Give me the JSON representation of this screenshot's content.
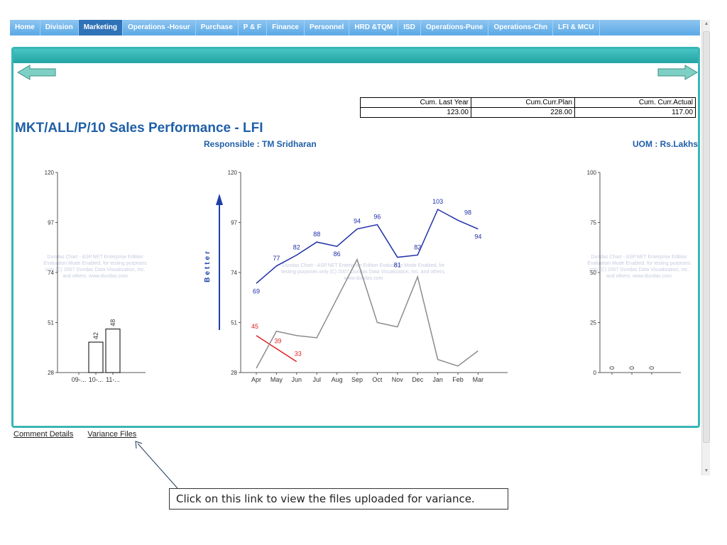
{
  "nav": {
    "tabs": [
      {
        "label": "Home",
        "active": false
      },
      {
        "label": "Division",
        "active": false
      },
      {
        "label": "Marketing",
        "active": true
      },
      {
        "label": "Operations -Hosur",
        "active": false
      },
      {
        "label": "Purchase",
        "active": false
      },
      {
        "label": "P & F",
        "active": false
      },
      {
        "label": "Finance",
        "active": false
      },
      {
        "label": "Personnel",
        "active": false
      },
      {
        "label": "HRD &TQM",
        "active": false
      },
      {
        "label": "ISD",
        "active": false
      },
      {
        "label": "Operations-Pune",
        "active": false
      },
      {
        "label": "Operations-Chn",
        "active": false
      },
      {
        "label": "LFI & MCU",
        "active": false
      }
    ]
  },
  "summary": {
    "headers": [
      "Cum. Last Year",
      "Cum.Curr.Plan",
      "Cum. Curr.Actual"
    ],
    "values": [
      "123.00",
      "228.00",
      "117.00"
    ]
  },
  "header": {
    "title": "MKT/ALL/P/10 Sales Performance - LFI",
    "responsible": "Responsible : TM Sridharan",
    "uom": "UOM : Rs.Lakhs"
  },
  "better_label": "Better",
  "watermark_text": "Dundas Chart - ASP.NET Enterprise Edition Evaluation Mode Enabled, for testing purposes only (C) 2007 Dundas Data Visualization, Inc. and others. www.dundas.com",
  "chart_data": [
    {
      "type": "bar",
      "categories": [
        "09-...",
        "10-...",
        "11-..."
      ],
      "values": [
        null,
        42,
        48
      ],
      "data_labels": [
        "",
        "42",
        "48"
      ],
      "ylim": [
        28,
        120
      ],
      "yticks": [
        28,
        51,
        74,
        97,
        120
      ]
    },
    {
      "type": "line",
      "categories": [
        "Apr",
        "May",
        "Jun",
        "Jul",
        "Aug",
        "Sep",
        "Oct",
        "Nov",
        "Dec",
        "Jan",
        "Feb",
        "Mar"
      ],
      "ylim": [
        28,
        120
      ],
      "yticks": [
        28,
        51,
        74,
        97,
        120
      ],
      "series": [
        {
          "color": "#1f2fa8",
          "values": [
            69,
            77,
            82,
            88,
            86,
            94,
            96,
            81,
            82,
            103,
            98,
            94
          ],
          "labels_shown": true
        },
        {
          "color": "#e02020",
          "values": [
            45,
            39,
            33,
            null,
            null,
            null,
            null,
            null,
            null,
            null,
            null,
            null
          ],
          "labels_shown": true
        },
        {
          "color": "#8c8c8c",
          "values": [
            30,
            47,
            45,
            44,
            62,
            80,
            51,
            49,
            72,
            34,
            31,
            38
          ],
          "labels_shown": false
        }
      ]
    },
    {
      "type": "bar",
      "categories": [
        "",
        "",
        ""
      ],
      "values": [
        0,
        0,
        0
      ],
      "data_labels": [
        "0",
        "0",
        "0"
      ],
      "ylim": [
        0,
        100
      ],
      "yticks": [
        0,
        25,
        50,
        75,
        100
      ]
    }
  ],
  "links": {
    "comment_details": "Comment Details",
    "variance_files": "Variance Files"
  },
  "callout": {
    "text": "Click on this link to view the files uploaded for variance."
  }
}
